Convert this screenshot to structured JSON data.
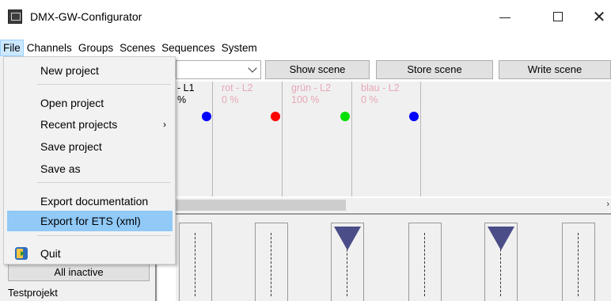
{
  "window": {
    "title": "DMX-GW-Configurator",
    "controls": {
      "minimize": "—",
      "close": "✕"
    }
  },
  "menubar": {
    "items": [
      "File",
      "Channels",
      "Groups",
      "Scenes",
      "Sequences",
      "System"
    ]
  },
  "file_menu": {
    "items": [
      {
        "label": "New project"
      },
      {
        "label": "Open project"
      },
      {
        "label": "Recent projects",
        "submenu_arrow": "›"
      },
      {
        "label": "Save project"
      },
      {
        "label": "Save as"
      },
      {
        "label": "Export documentation"
      },
      {
        "label": "Export for ETS (xml)",
        "highlighted": true
      },
      {
        "label": "Quit",
        "icon": "exit-door-icon"
      }
    ]
  },
  "toolbar": {
    "show_scene": "Show scene",
    "store_scene": "Store scene",
    "write_scene": "Write scene"
  },
  "channels": [
    {
      "name": "- L1",
      "value": "%",
      "color": "#0000ff"
    },
    {
      "name": "rot - L2",
      "value": "0 %",
      "color": "#ff0000"
    },
    {
      "name": "grün - L2",
      "value": "100 %",
      "color": "#00e000"
    },
    {
      "name": "blau - L2",
      "value": "0 %",
      "color": "#0000ff"
    }
  ],
  "scrollbar": {
    "right_arrow": "›"
  },
  "faders": [
    {
      "has_knob": false
    },
    {
      "has_knob": false
    },
    {
      "has_knob": true
    },
    {
      "has_knob": false
    },
    {
      "has_knob": true
    },
    {
      "has_knob": false
    }
  ],
  "left_panel": {
    "all_inactive": "All inactive",
    "project_name": "Testprojekt"
  },
  "colors": {
    "menu_highlight": "#91c9f7",
    "menu_active": "#cce8ff",
    "fader_knob": "#4a4d87",
    "faded_text": "#e6a8b6"
  }
}
